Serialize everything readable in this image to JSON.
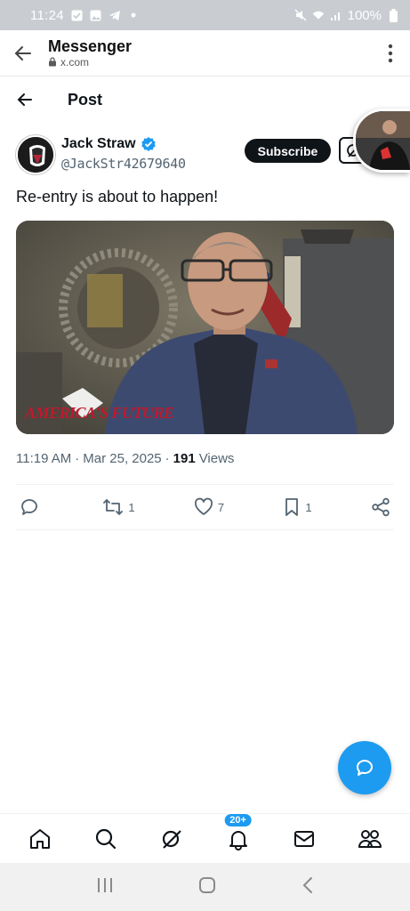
{
  "status_bar": {
    "time": "11:24",
    "battery": "100%"
  },
  "browser": {
    "title": "Messenger",
    "url": "x.com"
  },
  "post_header": {
    "title": "Post"
  },
  "author": {
    "name": "Jack Straw",
    "handle": "@JackStr42679640",
    "subscribe_label": "Subscribe"
  },
  "post": {
    "text": "Re-entry is about to happen!",
    "media_caption": "AMERICA'S FUTURE",
    "time": "11:19 AM",
    "date": "Mar 25, 2025",
    "views": "191",
    "views_label": "Views"
  },
  "actions": {
    "reply_count": "",
    "repost_count": "1",
    "like_count": "7",
    "bookmark_count": "1"
  },
  "nav": {
    "notifications_badge": "20+"
  },
  "colors": {
    "accent": "#1d9bf0",
    "text": "#0f1419",
    "muted": "#536471",
    "media_caption": "#c0192c"
  },
  "icons": [
    "back-arrow-icon",
    "lock-icon",
    "more-vert-icon",
    "verified-badge-icon",
    "grok-icon",
    "reply-icon",
    "repost-icon",
    "like-icon",
    "bookmark-icon",
    "share-icon",
    "compose-message-icon",
    "home-icon",
    "search-icon",
    "grok-nav-icon",
    "bell-icon",
    "mail-icon",
    "communities-icon"
  ]
}
